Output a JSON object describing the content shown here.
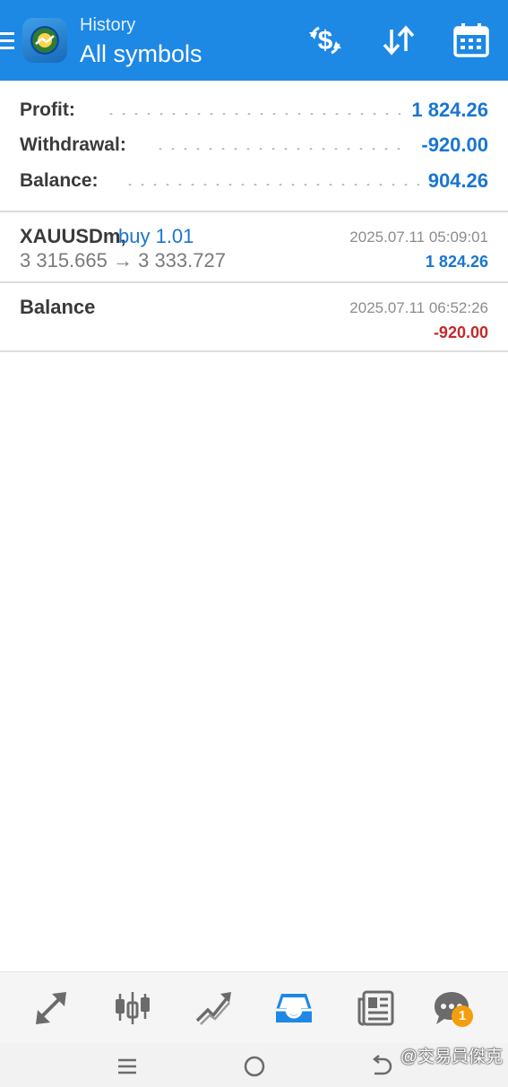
{
  "header": {
    "subtitle": "History",
    "title": "All symbols",
    "icons": [
      "menu-icon",
      "metatrader-logo",
      "currency-exchange-icon",
      "sort-icon",
      "calendar-icon"
    ]
  },
  "summary": {
    "profit": {
      "label": "Profit:",
      "value": "1 824.26"
    },
    "withdrawal": {
      "label": "Withdrawal:",
      "value": "-920.00"
    },
    "balance": {
      "label": "Balance:",
      "value": "904.26"
    }
  },
  "deals": [
    {
      "symbol": "XAUUSDm,",
      "side": "buy 1.01",
      "prices": "3 315.665 → 3 333.727",
      "time": "2025.07.11 05:09:01",
      "profit": "1 824.26"
    },
    {
      "symbol": "Balance",
      "time": "2025.07.11 06:52:26",
      "profit": "-920.00"
    }
  ],
  "bottom_nav": {
    "items": [
      "quotes-icon",
      "chart-icon",
      "trade-icon",
      "history-icon",
      "news-icon",
      "chat-icon"
    ],
    "active": "history-icon",
    "chat_badge": "1"
  },
  "system_bar": [
    "recent-apps-icon",
    "home-icon",
    "back-icon"
  ],
  "watermark": "@交易員傑克",
  "colors": {
    "header_bg": "#1e88e5",
    "positive": "#1976d2",
    "negative": "#c62828",
    "badge": "#f59e0b"
  }
}
